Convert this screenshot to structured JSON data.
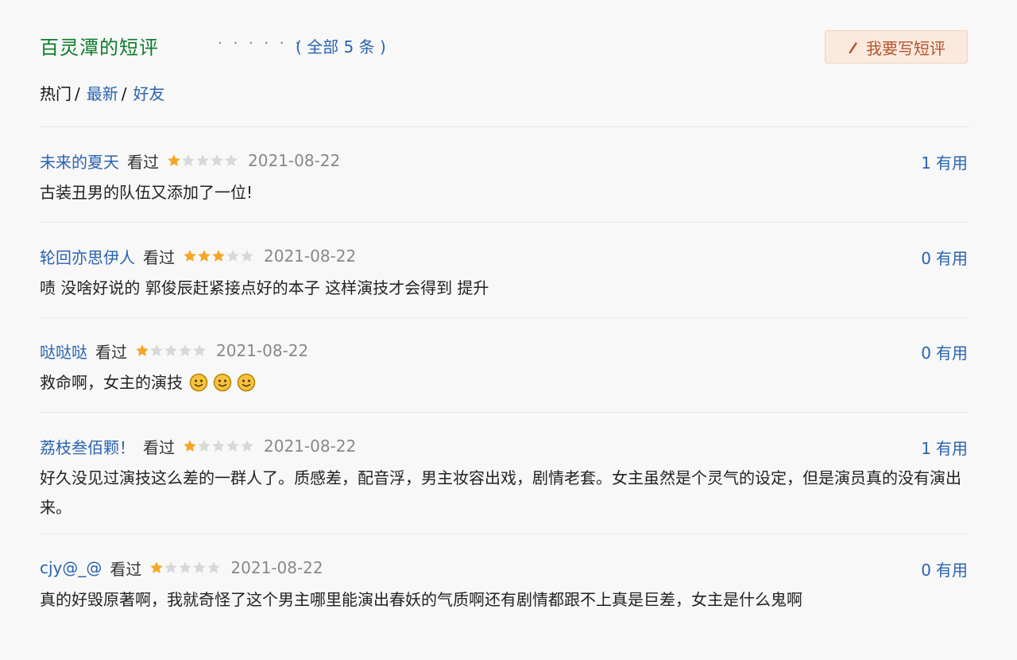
{
  "header": {
    "title": "百灵潭的短评",
    "dots": "· · · · · ·",
    "count_text": "( 全部 5 条 )",
    "write_button": "我要写短评"
  },
  "filters": [
    {
      "label": "热门",
      "sep": "/"
    },
    {
      "label": "最新",
      "sep": "/"
    },
    {
      "label": "好友",
      "sep": ""
    }
  ],
  "reviews": [
    {
      "user": "未来的夏天",
      "status": "看过",
      "rating": 1,
      "date": "2021-08-22",
      "useful_count": "1",
      "useful_label": "有用",
      "content": "古装丑男的队伍又添加了一位!"
    },
    {
      "user": "轮回亦思伊人",
      "status": "看过",
      "rating": 3,
      "date": "2021-08-22",
      "useful_count": "0",
      "useful_label": "有用",
      "content": "啧 没啥好说的 郭俊辰赶紧接点好的本子 这样演技才会得到 提升"
    },
    {
      "user": "哒哒哒",
      "status": "看过",
      "rating": 1,
      "date": "2021-08-22",
      "useful_count": "0",
      "useful_label": "有用",
      "content": "救命啊，女主的演技",
      "emoji_icon": "smile-emoji-icon"
    },
    {
      "user": "荔枝叁佰颗！",
      "status": "看过",
      "rating": 1,
      "date": "2021-08-22",
      "useful_count": "1",
      "useful_label": "有用",
      "content": "好久没见过演技这么差的一群人了。质感差，配音浮，男主妆容出戏，剧情老套。女主虽然是个灵气的设定，但是演员真的没有演出来。"
    },
    {
      "user": "cjy@_@",
      "status": "看过",
      "rating": 1,
      "date": "2021-08-22",
      "useful_count": "0",
      "useful_label": "有用",
      "content": "真的好毁原著啊，我就奇怪了这个男主哪里能演出春妖的气质啊还有剧情都跟不上真是巨差，女主是什么鬼啊"
    }
  ],
  "colors": {
    "title_green": "#0b7d2b",
    "link_blue": "#2a63b0",
    "star_gold": "#f5a623",
    "star_gray": "#d8d8d8",
    "button_bg": "#fbe9de",
    "button_text": "#b4542d"
  }
}
